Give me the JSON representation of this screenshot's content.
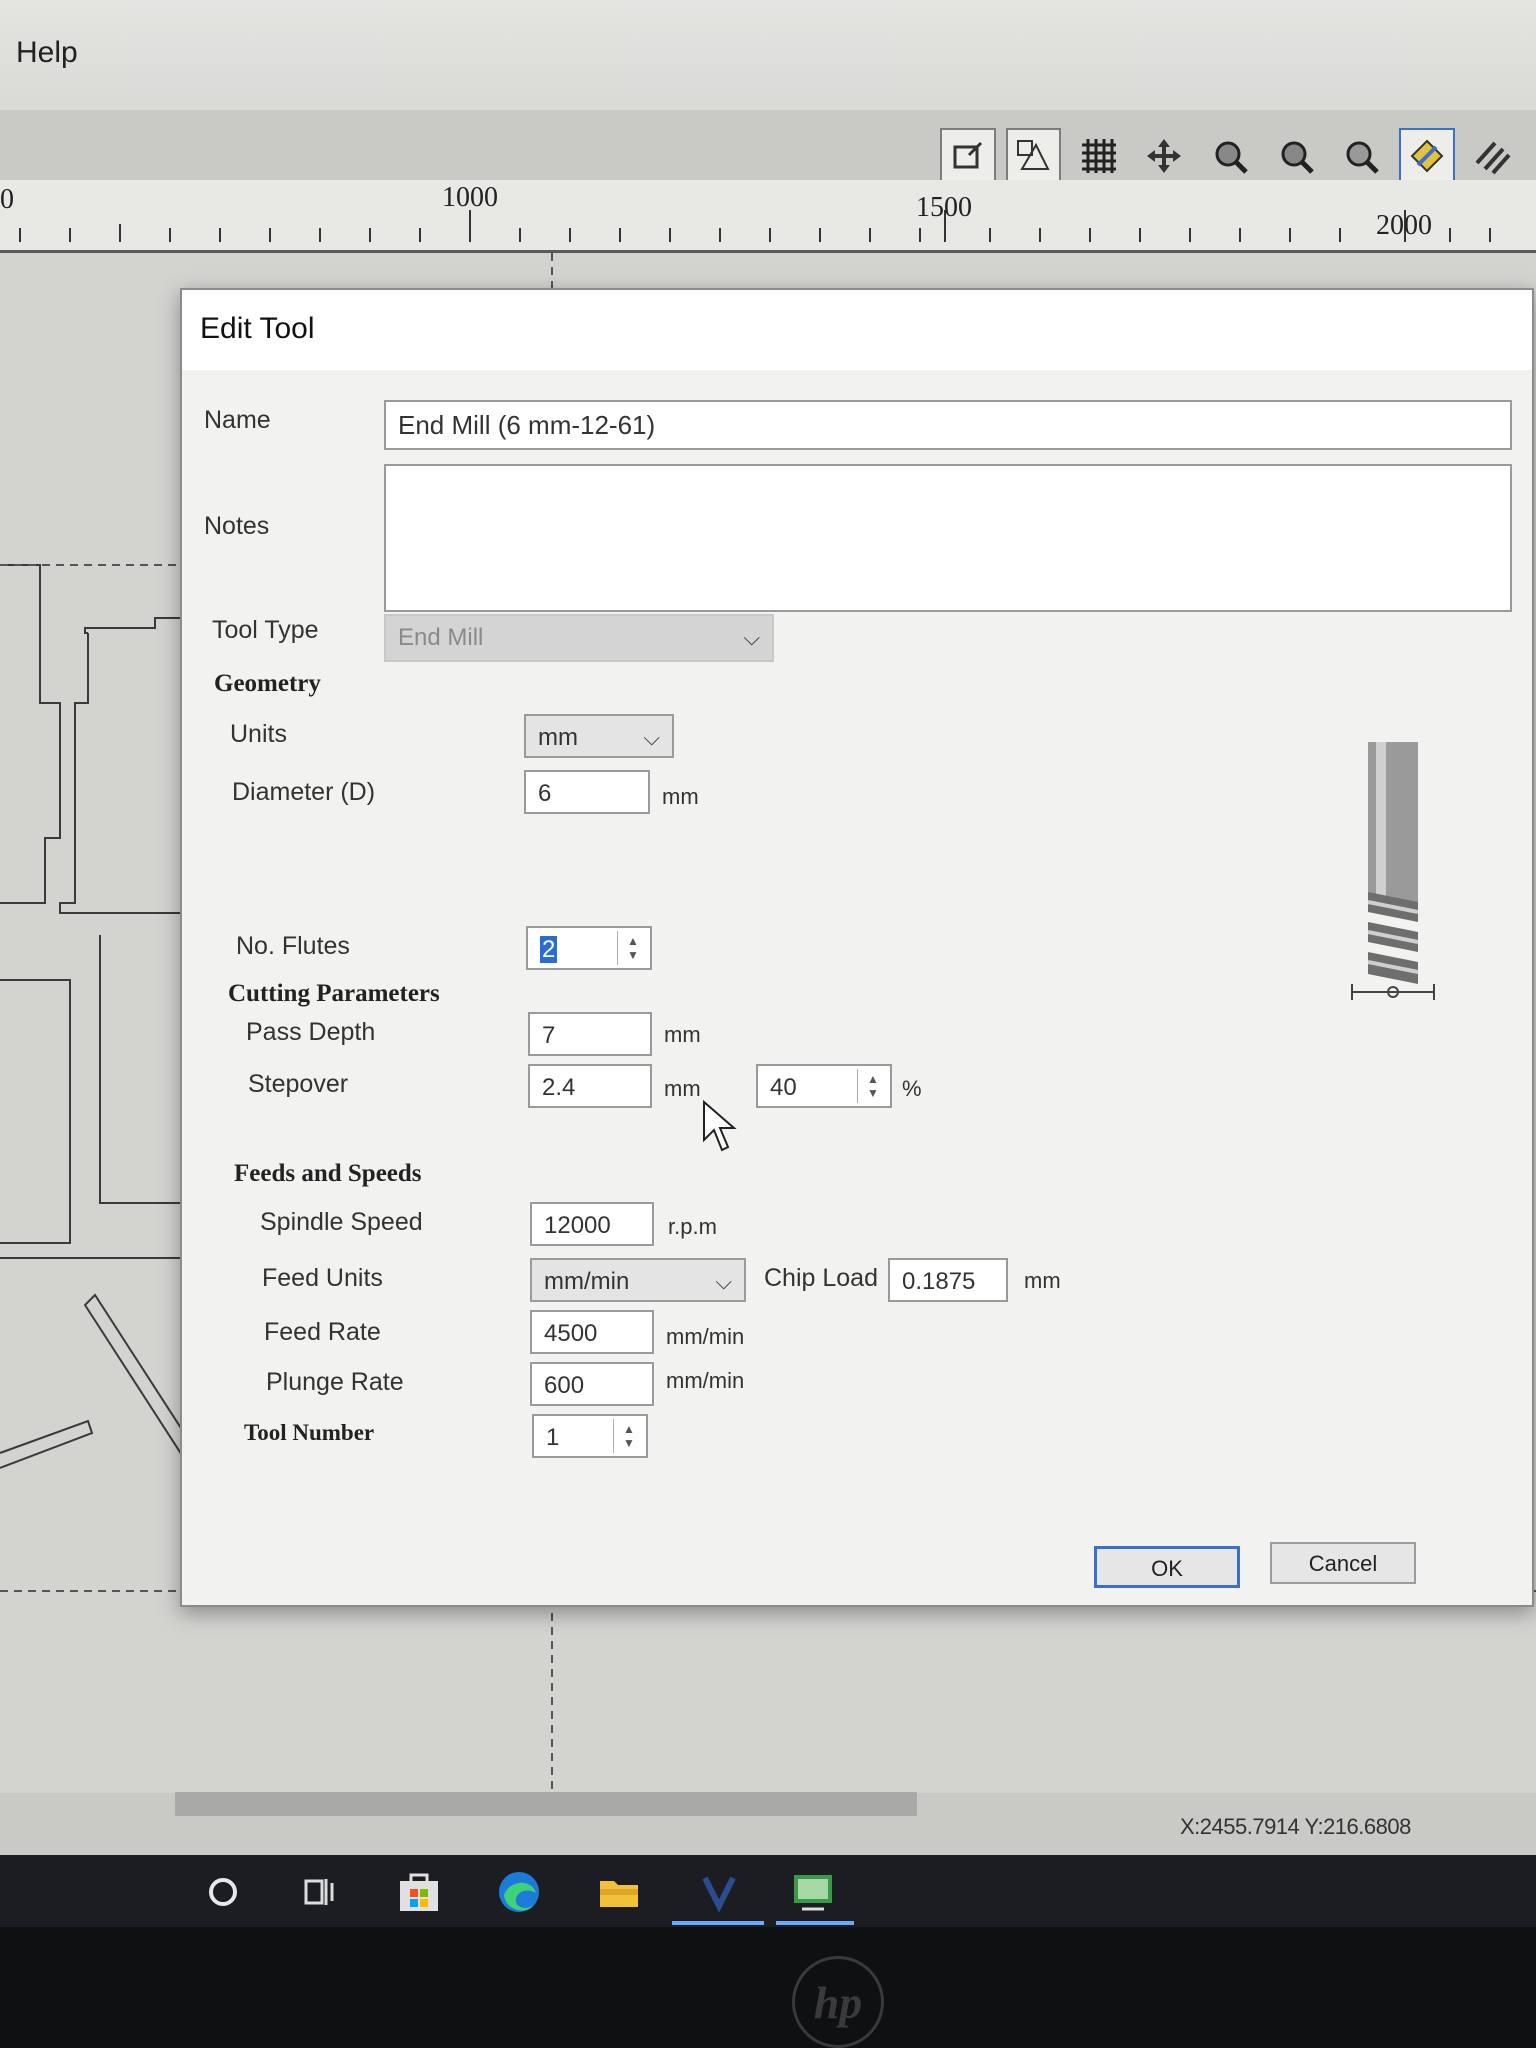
{
  "menubar": {
    "help_label": "Help"
  },
  "toolbar": {
    "icons": [
      "draw-rectangle-icon",
      "node-edit-icon",
      "grid-icon",
      "pan-icon",
      "zoom-in-icon",
      "zoom-out-icon",
      "zoom-extents-icon",
      "3d-view-icon",
      "layers-icon"
    ]
  },
  "ruler": {
    "labels": [
      "0",
      "1000",
      "1500",
      "2000"
    ]
  },
  "dialog": {
    "title": "Edit Tool",
    "name_label": "Name",
    "name_value": "End Mill (6 mm-12-61)",
    "notes_label": "Notes",
    "notes_value": "",
    "tool_type_label": "Tool Type",
    "tool_type_value": "End Mill",
    "geometry": {
      "heading": "Geometry",
      "units_label": "Units",
      "units_value": "mm",
      "diameter_label": "Diameter (D)",
      "diameter_value": "6",
      "diameter_unit": "mm",
      "flutes_label": "No. Flutes",
      "flutes_value": "2"
    },
    "cutting": {
      "heading": "Cutting Parameters",
      "pass_depth_label": "Pass Depth",
      "pass_depth_value": "7",
      "pass_depth_unit": "mm",
      "stepover_label": "Stepover",
      "stepover_value": "2.4",
      "stepover_unit": "mm",
      "stepover_percent_value": "40",
      "stepover_percent_unit": "%"
    },
    "feeds": {
      "heading": "Feeds and Speeds",
      "spindle_label": "Spindle Speed",
      "spindle_value": "12000",
      "spindle_unit": "r.p.m",
      "feed_units_label": "Feed Units",
      "feed_units_value": "mm/min",
      "chip_load_label": "Chip Load",
      "chip_load_value": "0.1875",
      "chip_load_unit": "mm",
      "feed_rate_label": "Feed Rate",
      "feed_rate_value": "4500",
      "feed_rate_unit": "mm/min",
      "plunge_rate_label": "Plunge Rate",
      "plunge_rate_value": "600",
      "plunge_rate_unit": "mm/min"
    },
    "tool_number_label": "Tool Number",
    "tool_number_value": "1",
    "ok_label": "OK",
    "cancel_label": "Cancel"
  },
  "status": {
    "coords": "X:2455.7914 Y:216.6808"
  },
  "taskbar": {
    "icons": [
      "search-circle-icon",
      "task-view-icon",
      "store-icon",
      "edge-icon",
      "file-explorer-icon",
      "vcarve-icon",
      "app-icon"
    ]
  },
  "monitor": {
    "logo_text": "hp"
  }
}
